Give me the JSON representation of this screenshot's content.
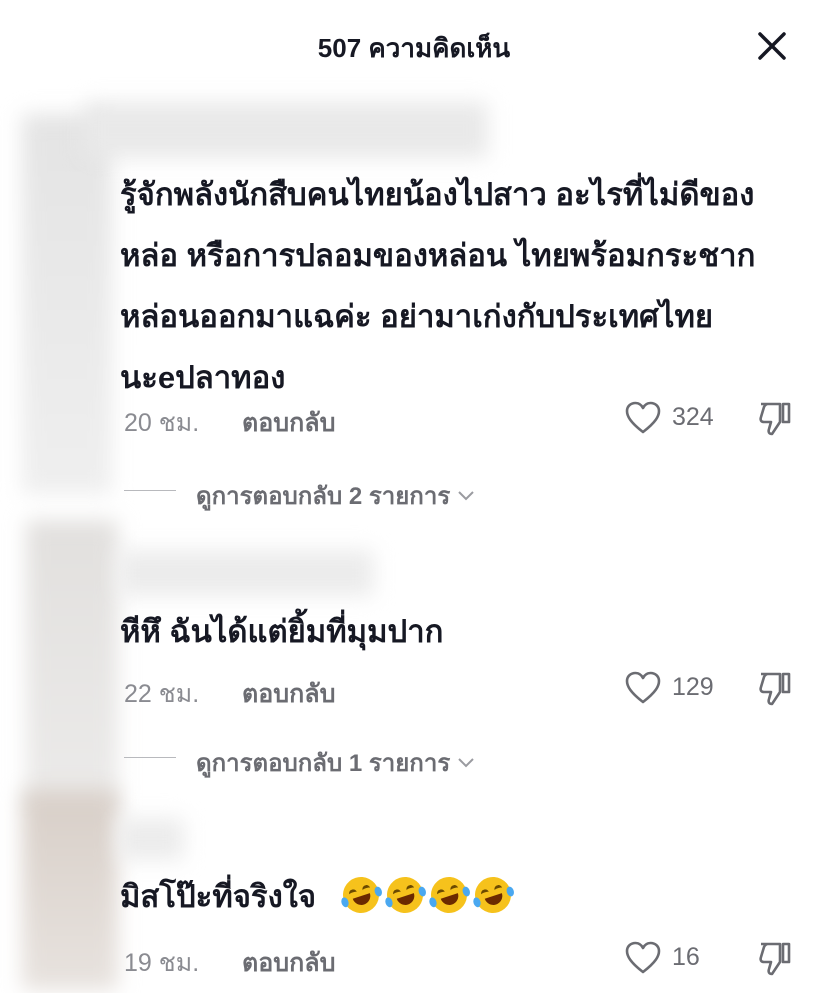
{
  "header": {
    "title": "507 ความคิดเห็น"
  },
  "comments": [
    {
      "lines": [
        "รู้จักพลังนักสืบคนไทยน้องไปสาว อะไรที่ไม่ดีของ",
        "หล่อ หรือการปลอมของหล่อน ไทยพร้อมกระชาก",
        "หล่อนออกมาแฉค่ะ อย่ามาเก่งกับประเทศไทย",
        "นะeปลาทอง"
      ],
      "time": "20 ชม.",
      "reply_label": "ตอบกลับ",
      "likes": "324",
      "view_replies": "ดูการตอบกลับ 2 รายการ"
    },
    {
      "lines": [
        "หีหึ ฉันได้แต่ยิ้มที่มุมปาก"
      ],
      "time": "22 ชม.",
      "reply_label": "ตอบกลับ",
      "likes": "129",
      "view_replies": "ดูการตอบกลับ 1 รายการ"
    },
    {
      "lines": [
        "มิสโป๊ะที่จริงใจ"
      ],
      "emoji_count": 4,
      "emoji_name": "rolling-on-floor-laughing",
      "time": "19 ชม.",
      "reply_label": "ตอบกลับ",
      "likes": "16"
    }
  ],
  "icons": {
    "close": "close-icon",
    "like": "heart-outline-icon",
    "dislike": "thumbs-down-icon",
    "expand": "chevron-down-icon"
  }
}
